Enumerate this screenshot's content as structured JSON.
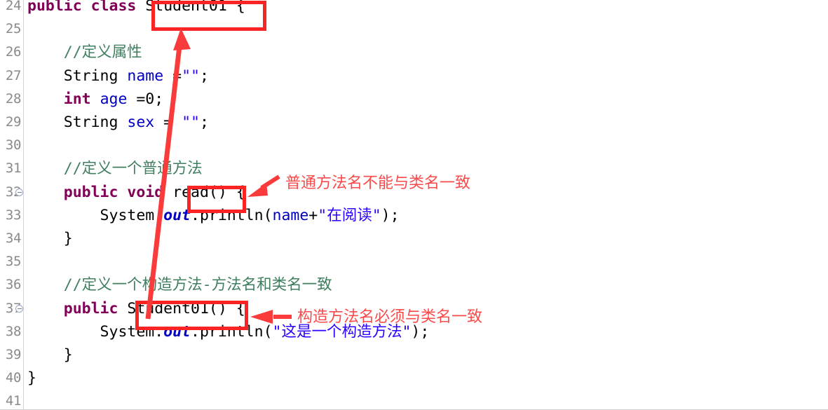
{
  "editor": {
    "language": "java",
    "first_visible_line": 24,
    "last_visible_line": 41,
    "gutter_bg": "#ffffff",
    "code_bg": "#ffffff",
    "colors": {
      "keyword": "#7f0055",
      "field": "#0000c0",
      "string": "#2a00ff",
      "comment": "#3f7f5f",
      "static_field": "#0000c0",
      "line_number": "#8a8a8a",
      "annotation_red": "#fb2424",
      "annotation_text_red": "#fb4a4a"
    },
    "fold_markers": [
      32,
      37
    ],
    "line_numbers": [
      "24",
      "25",
      "26",
      "27",
      "28",
      "29",
      "30",
      "31",
      "32",
      "33",
      "34",
      "35",
      "36",
      "37",
      "38",
      "39",
      "40",
      "41"
    ],
    "lines": [
      {
        "number": "24",
        "tokens": [
          {
            "t": "public",
            "c": "kw"
          },
          {
            "t": " ",
            "c": "plain"
          },
          {
            "t": "class",
            "c": "kw"
          },
          {
            "t": " Student01 {",
            "c": "plain"
          }
        ]
      },
      {
        "number": "25",
        "tokens": []
      },
      {
        "number": "26",
        "tokens": [
          {
            "t": "    ",
            "c": "plain"
          },
          {
            "t": "//定义属性",
            "c": "cmt"
          }
        ]
      },
      {
        "number": "27",
        "tokens": [
          {
            "t": "    String ",
            "c": "plain"
          },
          {
            "t": "name",
            "c": "fld"
          },
          {
            "t": " =",
            "c": "plain"
          },
          {
            "t": "\"\"",
            "c": "str"
          },
          {
            "t": ";",
            "c": "plain"
          }
        ]
      },
      {
        "number": "28",
        "tokens": [
          {
            "t": "    ",
            "c": "plain"
          },
          {
            "t": "int",
            "c": "kw"
          },
          {
            "t": " ",
            "c": "plain"
          },
          {
            "t": "age",
            "c": "fld"
          },
          {
            "t": " =0;",
            "c": "plain"
          }
        ]
      },
      {
        "number": "29",
        "tokens": [
          {
            "t": "    String ",
            "c": "plain"
          },
          {
            "t": "sex",
            "c": "fld"
          },
          {
            "t": " = ",
            "c": "plain"
          },
          {
            "t": "\"\"",
            "c": "str"
          },
          {
            "t": ";",
            "c": "plain"
          }
        ]
      },
      {
        "number": "30",
        "tokens": []
      },
      {
        "number": "31",
        "tokens": [
          {
            "t": "    ",
            "c": "plain"
          },
          {
            "t": "//定义一个普通方法",
            "c": "cmt"
          }
        ]
      },
      {
        "number": "32",
        "tokens": [
          {
            "t": "    ",
            "c": "plain"
          },
          {
            "t": "public",
            "c": "kw"
          },
          {
            "t": " ",
            "c": "plain"
          },
          {
            "t": "void",
            "c": "kw"
          },
          {
            "t": " read() {",
            "c": "plain"
          }
        ]
      },
      {
        "number": "33",
        "tokens": [
          {
            "t": "        System.",
            "c": "plain"
          },
          {
            "t": "out",
            "c": "stat"
          },
          {
            "t": ".println(",
            "c": "plain"
          },
          {
            "t": "name",
            "c": "fld"
          },
          {
            "t": "+",
            "c": "plain"
          },
          {
            "t": "\"在阅读\"",
            "c": "str"
          },
          {
            "t": ");",
            "c": "plain"
          }
        ]
      },
      {
        "number": "34",
        "tokens": [
          {
            "t": "    }",
            "c": "plain"
          }
        ]
      },
      {
        "number": "35",
        "tokens": []
      },
      {
        "number": "36",
        "tokens": [
          {
            "t": "    ",
            "c": "plain"
          },
          {
            "t": "//定义一个构造方法-方法名和类名一致",
            "c": "cmt"
          }
        ]
      },
      {
        "number": "37",
        "tokens": [
          {
            "t": "    ",
            "c": "plain"
          },
          {
            "t": "public",
            "c": "kw"
          },
          {
            "t": " Student01() {",
            "c": "plain"
          }
        ]
      },
      {
        "number": "38",
        "tokens": [
          {
            "t": "        System.",
            "c": "plain"
          },
          {
            "t": "out",
            "c": "stat"
          },
          {
            "t": ".println(",
            "c": "plain"
          },
          {
            "t": "\"这是一个构造方法\"",
            "c": "str"
          },
          {
            "t": ");",
            "c": "plain"
          }
        ]
      },
      {
        "number": "39",
        "tokens": [
          {
            "t": "    }",
            "c": "plain"
          }
        ]
      },
      {
        "number": "40",
        "tokens": [
          {
            "t": "}",
            "c": "plain"
          }
        ]
      },
      {
        "number": "41",
        "tokens": []
      }
    ]
  },
  "annotations": {
    "boxes": [
      {
        "id": "class-name-box",
        "target": "Student01 (class declaration, line 24)"
      },
      {
        "id": "method-name-box",
        "target": "read( (method declaration, line 32)"
      },
      {
        "id": "constructor-name-box",
        "target": "Student01( (constructor declaration, line 37)"
      }
    ],
    "labels": [
      {
        "id": "ordinary-method-note",
        "text": "普通方法名不能与类名一致"
      },
      {
        "id": "constructor-note",
        "text": "构造方法名必须与类名一致"
      }
    ],
    "arrows": [
      {
        "id": "constructor-to-class-arrow",
        "from": "constructor Student01 (line 37)",
        "to": "class Student01 (line 24)"
      },
      {
        "id": "ordinary-method-arrow",
        "from": "普通方法名不能与类名一致",
        "to": "read( box (line 32)"
      },
      {
        "id": "constructor-note-arrow",
        "from": "构造方法名必须与类名一致",
        "to": "Student01( box (line 37)"
      }
    ]
  }
}
